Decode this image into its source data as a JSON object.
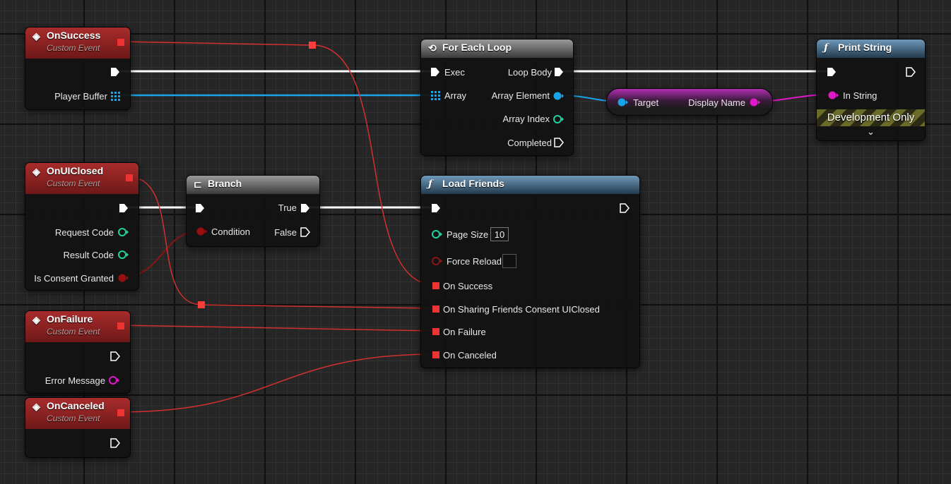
{
  "nodes": {
    "on_success": {
      "title": "OnSuccess",
      "subtitle": "Custom Event",
      "pins": {
        "player_buffer": "Player Buffer"
      }
    },
    "on_ui_closed": {
      "title": "OnUIClosed",
      "subtitle": "Custom Event",
      "pins": {
        "request_code": "Request Code",
        "result_code": "Result Code",
        "is_consent_granted": "Is Consent Granted"
      }
    },
    "on_failure": {
      "title": "OnFailure",
      "subtitle": "Custom Event",
      "pins": {
        "error_message": "Error Message"
      }
    },
    "on_canceled": {
      "title": "OnCanceled",
      "subtitle": "Custom Event"
    },
    "branch": {
      "title": "Branch",
      "pins": {
        "condition": "Condition",
        "true": "True",
        "false": "False"
      }
    },
    "for_each_loop": {
      "title": "For Each Loop",
      "pins": {
        "exec": "Exec",
        "array": "Array",
        "loop_body": "Loop Body",
        "array_element": "Array Element",
        "array_index": "Array Index",
        "completed": "Completed"
      }
    },
    "get_display_name": {
      "pins": {
        "target": "Target",
        "display_name": "Display Name"
      }
    },
    "print_string": {
      "title": "Print String",
      "pins": {
        "in_string": "In String"
      },
      "dev_only": "Development Only",
      "expand_icon": "⌄"
    },
    "load_friends": {
      "title": "Load Friends",
      "pins": {
        "page_size": "Page Size",
        "page_size_value": "10",
        "force_reload": "Force Reload",
        "on_success": "On Success",
        "on_sharing_consent": "On Sharing Friends Consent UIClosed",
        "on_failure": "On Failure",
        "on_canceled": "On Canceled"
      }
    }
  },
  "colors": {
    "exec": "#ffffff",
    "event_delegate": "#e33333",
    "array": "#18a4e8",
    "integer": "#1fd3a0",
    "boolean": "#9a0f0f",
    "string": "#f01cd0"
  },
  "icons": {
    "event": "diamond-arrow-icon",
    "function": "function-f-icon",
    "branch": "branch-icon",
    "macro": "loop-icon"
  }
}
